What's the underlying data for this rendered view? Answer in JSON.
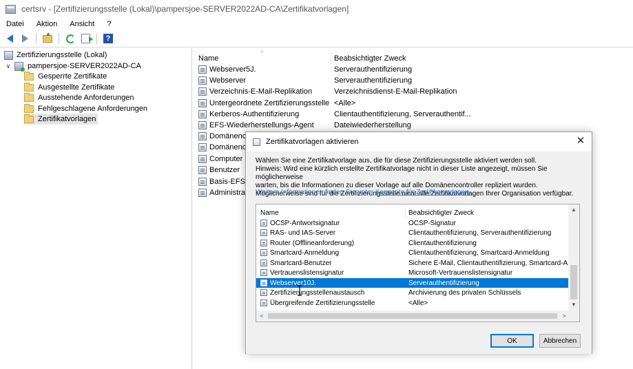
{
  "window": {
    "title": "certsrv - [Zertifizierungsstelle (Lokal)\\pampersjoe-SERVER2022AD-CA\\Zertifikatvorlagen]"
  },
  "menu": [
    "Datei",
    "Aktion",
    "Ansicht",
    "?"
  ],
  "toolbar": {
    "buttons": [
      "back-arrow-icon",
      "forward-arrow-icon",
      "folder-up-icon",
      "refresh-icon",
      "export-list-icon",
      "help-icon"
    ],
    "help_label": "?"
  },
  "tree": {
    "root": "Zertifizierungsstelle (Lokal)",
    "ca": "pampersjoe-SERVER2022AD-CA",
    "ca_chevron": "∨",
    "items": [
      "Gesperrte Zertifikate",
      "Ausgestellte Zertifikate",
      "Ausstehende Anforderungen",
      "Fehlgeschlagene Anforderungen",
      "Zertifikatvorlagen"
    ],
    "selected_index": 4
  },
  "list": {
    "sort_caret": "⌄",
    "columns": [
      "Name",
      "Beabsichtigter Zweck"
    ],
    "rows": [
      {
        "name": "Webserver5J.",
        "purpose": "Serverauthentifizierung"
      },
      {
        "name": "Webserver",
        "purpose": "Serverauthentifizierung"
      },
      {
        "name": "Verzeichnis-E-Mail-Replikation",
        "purpose": "Verzeichnisdienst-E-Mail-Replikation"
      },
      {
        "name": "Untergeordnete Zertifizierungsstelle",
        "purpose": "<Alle>"
      },
      {
        "name": "Kerberos-Authentifizierung",
        "purpose": "Clientauthentifizierung, Serverauthentif..."
      },
      {
        "name": "EFS-Wiederherstellungs-Agent",
        "purpose": "Dateiwiederherstellung"
      },
      {
        "name": "Domänenco",
        "purpose": ""
      },
      {
        "name": "Domänenco",
        "purpose": ""
      },
      {
        "name": "Computer",
        "purpose": ""
      },
      {
        "name": "Benutzer",
        "purpose": ""
      },
      {
        "name": "Basis-EFS",
        "purpose": ""
      },
      {
        "name": "Administrato",
        "purpose": ""
      }
    ]
  },
  "dialog": {
    "title": "Zertifikatvorlagen aktivieren",
    "close_label": "✕",
    "text_lines": [
      "Wählen Sie eine Zertifikatvorlage aus, die für diese Zertifizierungsstelle aktiviert werden soll.",
      "Hinweis: Wird eine kürzlich erstellte Zertifikatvorlage nicht in dieser Liste angezeigt, müssen Sie möglicherweise",
      "warten, bis die Informationen zu dieser Vorlage auf alle Domänencontroller repliziert wurden.",
      "Möglicherweise sind für die Zertifizierungsstelle nicht alle Zertifikatvorlagen Ihrer Organisation verfügbar."
    ],
    "link_prefix": "Weitere Informationen finden Sie unter",
    "link_text": "Konzepte für Zertifikatvorlagen",
    "link_suffix": ".",
    "columns": [
      "Name",
      "Beabsichtigter Zweck"
    ],
    "rows": [
      {
        "name": "OCSP-Antwortsignatur",
        "purpose": "OCSP-Signatur"
      },
      {
        "name": "RAS- und IAS-Server",
        "purpose": "Clientauthentifizierung, Serverauthentifizierung"
      },
      {
        "name": "Router (Offlineanforderung)",
        "purpose": "Clientauthentifizierung"
      },
      {
        "name": "Smartcard-Anmeldung",
        "purpose": "Clientauthentifizierung, Smartcard-Anmeldung"
      },
      {
        "name": "Smartcard-Benutzer",
        "purpose": "Sichere E-Mail, Clientauthentifizierung, Smartcard-Anmeldu"
      },
      {
        "name": "Vertrauenslistensignatur",
        "purpose": "Microsoft-Vertrauenslistensignatur"
      },
      {
        "name": "Webserver10J.",
        "purpose": "Serverauthentifizierung"
      },
      {
        "name": "Zertifizierungsstellenaustausch",
        "purpose": "Archivierung des privaten Schlüssels"
      },
      {
        "name": "Übergreifende Zertifizierungsstelle",
        "purpose": "<Alle>"
      }
    ],
    "selected_index": 6,
    "scroll": {
      "up": "▲",
      "down": "▼",
      "left": "<",
      "right": ">"
    },
    "ok_label": "OK",
    "cancel_label": "Abbrechen"
  },
  "colors": {
    "selection": "#0078d7",
    "link": "#2a6fc9"
  }
}
